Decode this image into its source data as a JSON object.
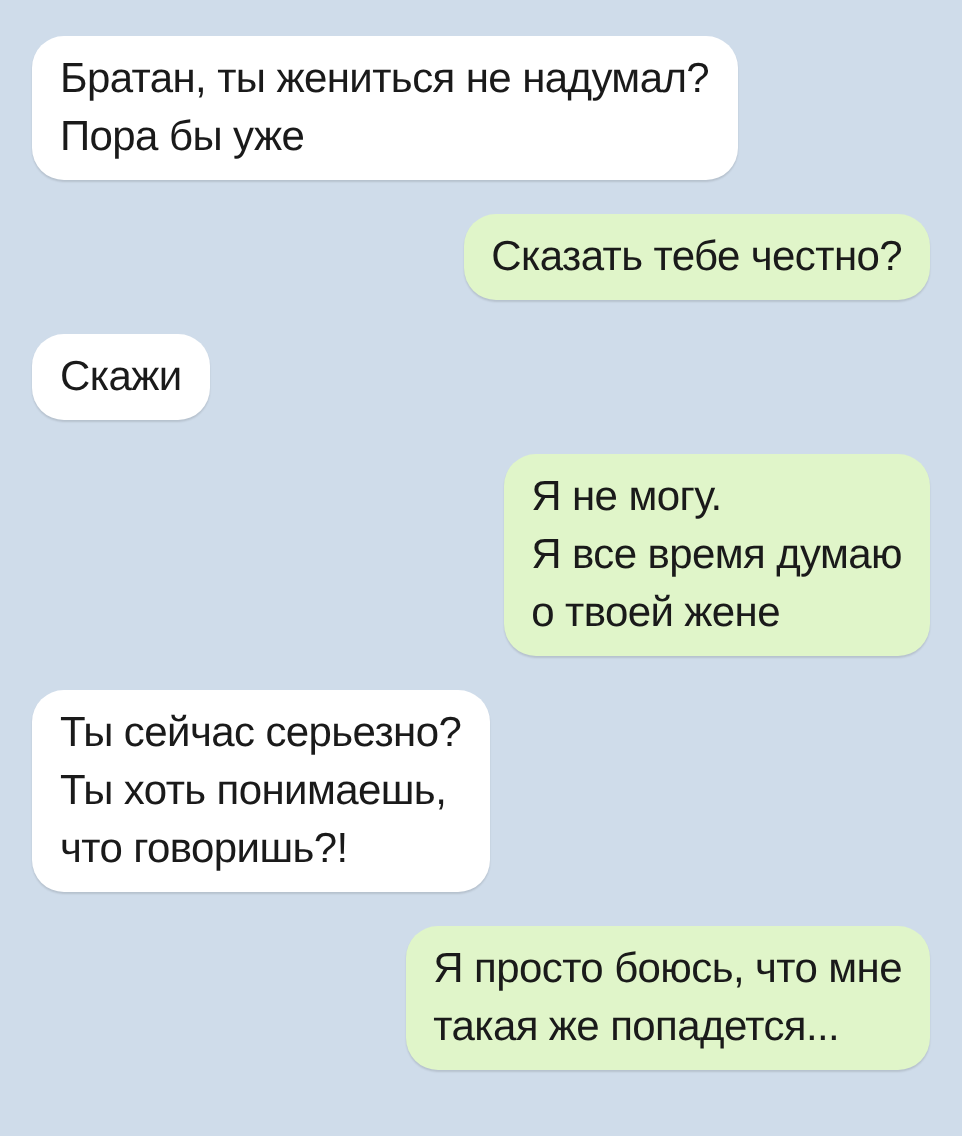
{
  "messages": [
    {
      "kind": "incoming",
      "lines": [
        "Братан, ты жениться не надумал?",
        "Пора бы уже"
      ]
    },
    {
      "kind": "outgoing",
      "lines": [
        "Сказать тебе честно?"
      ]
    },
    {
      "kind": "incoming",
      "lines": [
        "Скажи"
      ]
    },
    {
      "kind": "outgoing",
      "lines": [
        "Я не могу.",
        "Я все время думаю",
        "о твоей жене"
      ]
    },
    {
      "kind": "incoming",
      "lines": [
        "Ты сейчас серьезно?",
        "Ты хоть понимаешь,",
        "что говоришь?!"
      ]
    },
    {
      "kind": "outgoing",
      "lines": [
        "Я просто боюсь, что мне",
        "такая же попадется..."
      ]
    }
  ]
}
